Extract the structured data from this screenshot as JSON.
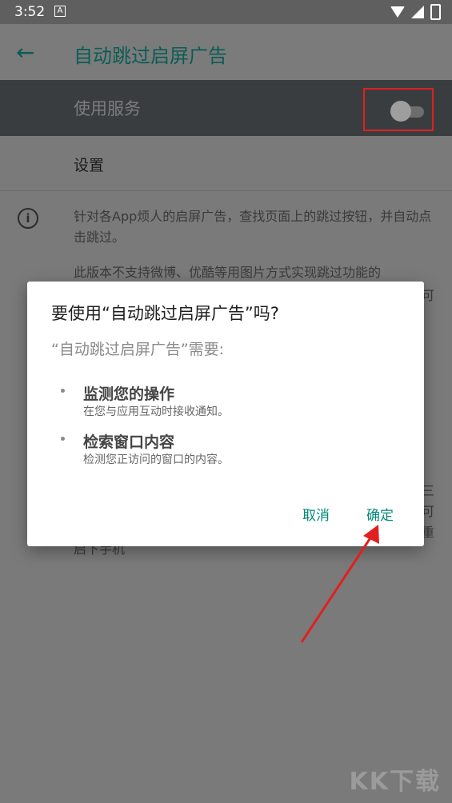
{
  "status_bar": {
    "time": "3:52",
    "notification_glyph": "A"
  },
  "app_bar": {
    "back_icon": "arrow-left-icon",
    "title": "自动跳过启屏广告"
  },
  "service": {
    "label": "使用服务",
    "toggle_state": "off"
  },
  "settings": {
    "label": "设置"
  },
  "info": {
    "icon": "info-icon",
    "paragraph1": "针对各App烦人的启屏广告，查找页面上的跳过按钮，并自动点击跳过。",
    "paragraph2": "此版本不支持微博、优酷等用图片方式实现跳过功能的",
    "edge_char_1": "可",
    "edge_char_2": "三",
    "edge_char_3": "可",
    "edge_char_4": "重",
    "paragraph3": "启下手机"
  },
  "dialog": {
    "title": "要使用“自动跳过启屏广告”吗?",
    "subtitle": "“自动跳过启屏广告”需要:",
    "permissions": [
      {
        "title": "监测您的操作",
        "description": "在您与应用互动时接收通知。"
      },
      {
        "title": "检索窗口内容",
        "description": "检测您正访问的窗口的内容。"
      }
    ],
    "cancel_label": "取消",
    "confirm_label": "确定"
  },
  "annotation": {
    "arrow_color": "#e02020",
    "box_color": "#e02020"
  },
  "watermark": "KK下载"
}
